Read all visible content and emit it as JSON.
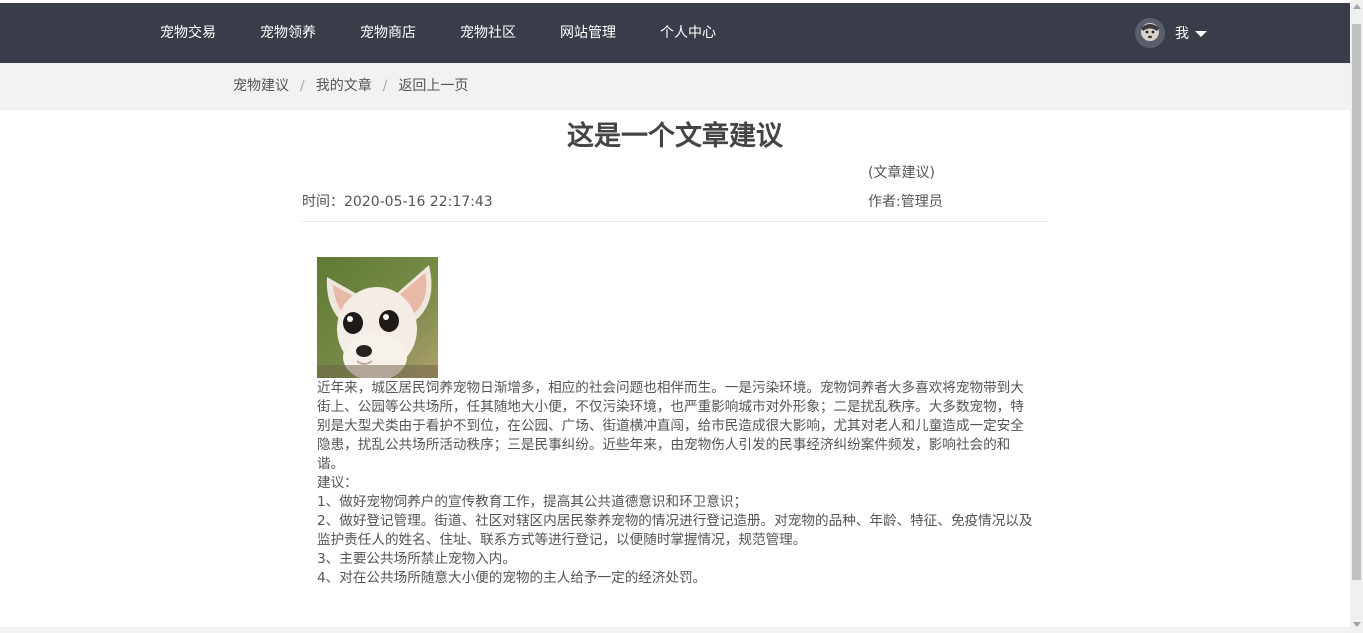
{
  "nav": {
    "items": [
      {
        "label": "宠物交易"
      },
      {
        "label": "宠物领养"
      },
      {
        "label": "宠物商店"
      },
      {
        "label": "宠物社区"
      },
      {
        "label": "网站管理"
      },
      {
        "label": "个人中心"
      }
    ],
    "user_label": "我"
  },
  "breadcrumb": {
    "items": [
      {
        "label": "宠物建议"
      },
      {
        "label": "我的文章"
      },
      {
        "label": "返回上一页"
      }
    ],
    "separator": "/"
  },
  "article": {
    "title": "这是一个文章建议",
    "category": "(文章建议)",
    "time": "时间：2020-05-16 22:17:43",
    "author": "作者:管理员",
    "paragraphs": [
      "近年来，城区居民饲养宠物日渐增多，相应的社会问题也相伴而生。一是污染环境。宠物饲养者大多喜欢将宠物带到大街上、公园等公共场所，任其随地大小便，不仅污染环境，也严重影响城市对外形象；二是扰乱秩序。大多数宠物，特别是大型犬类由于看护不到位，在公园、广场、街道横冲直闯，给市民造成很大影响，尤其对老人和儿童造成一定安全隐患，扰乱公共场所活动秩序；三是民事纠纷。近些年来，由宠物伤人引发的民事经济纠纷案件频发，影响社会的和谐。",
      "建议：",
      "1、做好宠物饲养户的宣传教育工作，提高其公共道德意识和环卫意识；",
      "2、做好登记管理。街道、社区对辖区内居民豢养宠物的情况进行登记造册。对宠物的品种、年龄、特征、免疫情况以及监护责任人的姓名、住址、联系方式等进行登记，以便随时掌握情况，规范管理。",
      "3、主要公共场所禁止宠物入内。",
      "4、对在公共场所随意大小便的宠物的主人给予一定的经济处罚。"
    ]
  },
  "colors": {
    "navbar_bg": "#393d49",
    "breadcrumb_bg": "#f2f2f0",
    "text": "#555555"
  }
}
